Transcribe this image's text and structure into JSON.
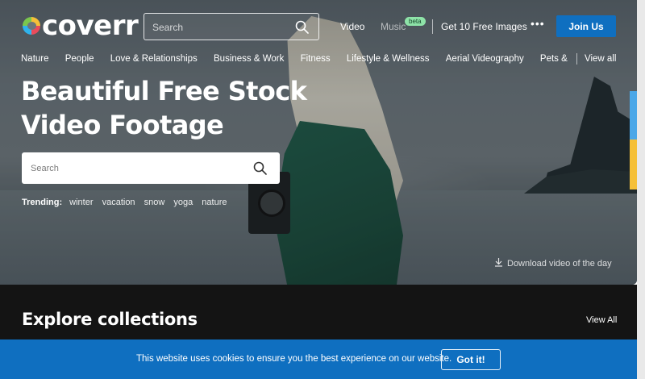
{
  "header": {
    "logo_text": "coverr",
    "search_placeholder": "Search",
    "nav": {
      "video": "Video",
      "music": "Music",
      "music_badge": "beta",
      "free_images": "Get 10 Free Images",
      "more": "•••",
      "join": "Join Us"
    }
  },
  "categories": {
    "items": [
      "Nature",
      "People",
      "Love & Relationships",
      "Business & Work",
      "Fitness",
      "Lifestyle & Wellness",
      "Aerial Videography",
      "Pets & Anim"
    ],
    "view_all": "View all"
  },
  "hero": {
    "title_line1": "Beautiful Free Stock",
    "title_line2": "Video Footage",
    "search_placeholder": "Search",
    "trending_label": "Trending:",
    "trending_tags": [
      "winter",
      "vacation",
      "snow",
      "yoga",
      "nature"
    ],
    "download_text": "Download video of the day"
  },
  "explore": {
    "title": "Explore collections",
    "view_all": "View All"
  },
  "cookie": {
    "text": "This website uses cookies to ensure you the best experience on our website.",
    "button": "Got it!"
  },
  "colors": {
    "brand_blue": "#0f6fc0",
    "accent_blue": "#4aa7e8",
    "accent_yellow": "#f5c038",
    "beta_green": "#8ee3a8",
    "dark_section": "#141414"
  },
  "icons": {
    "search": "search-icon",
    "download": "download-icon",
    "more": "more-dots-icon"
  }
}
